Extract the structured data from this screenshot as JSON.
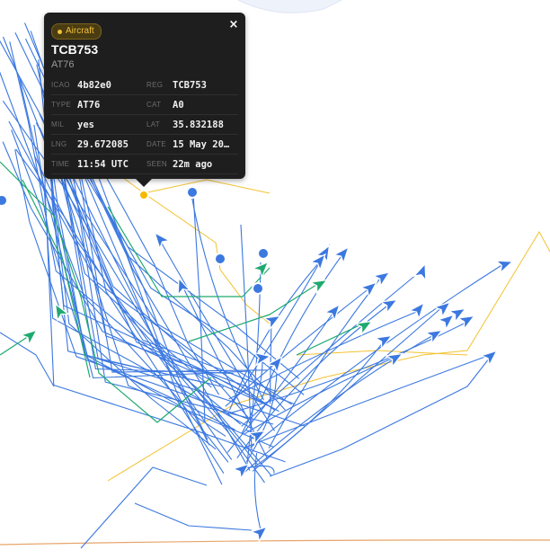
{
  "popup": {
    "badge_label": "Aircraft",
    "close_glyph": "×",
    "callsign": "TCB753",
    "subtitle": "AT76",
    "fields": [
      {
        "key": "ICAO",
        "value": "4b82e0"
      },
      {
        "key": "REG",
        "value": "TCB753"
      },
      {
        "key": "TYPE",
        "value": "AT76"
      },
      {
        "key": "CAT",
        "value": "A0"
      },
      {
        "key": "MIL",
        "value": "yes"
      },
      {
        "key": "LAT",
        "value": "35.832188"
      },
      {
        "key": "LNG",
        "value": "29.672085"
      },
      {
        "key": "DATE",
        "value": "15 May 20…"
      },
      {
        "key": "TIME",
        "value": "11:54 UTC"
      },
      {
        "key": "SEEN",
        "value": "22m ago"
      }
    ]
  },
  "colors": {
    "track_blue": "#3b78e0",
    "track_green": "#1eaa6e",
    "route_yellow": "#f2c230",
    "boundary_orange": "#e8a46a",
    "selected_marker": "#f5b800",
    "popup_bg": "#1e1e1e"
  },
  "map": {
    "markers": [
      {
        "icon": "aircraft-arrow-icon",
        "color": "blue"
      },
      {
        "icon": "aircraft-arrow-icon",
        "color": "green"
      },
      {
        "icon": "aircraft-dot-icon",
        "color": "blue"
      },
      {
        "icon": "selected-aircraft-dot-icon",
        "color": "yellow"
      }
    ]
  }
}
